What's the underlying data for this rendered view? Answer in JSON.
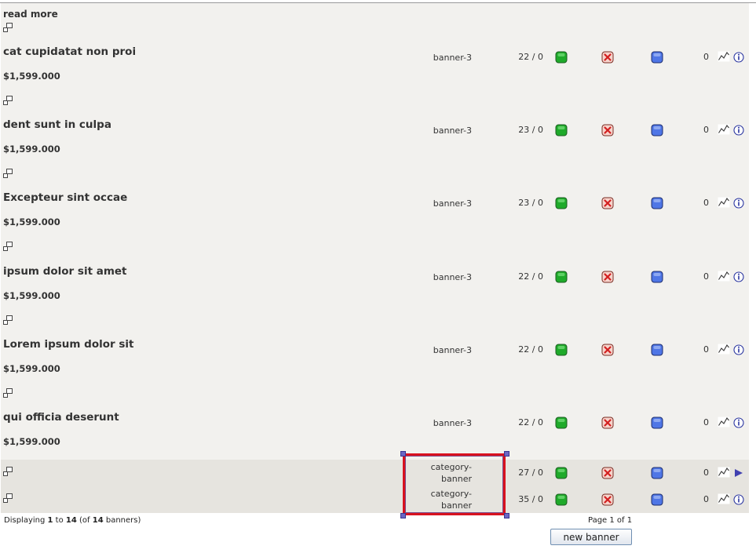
{
  "read_more": "read more",
  "banners": [
    {
      "title": "cat cupidatat non proi",
      "price": "$1,599.000",
      "zone": "banner-3",
      "ratio": "22 / 0",
      "count": "0",
      "last_icon": "info-icon"
    },
    {
      "title": "dent sunt in culpa",
      "price": "$1,599.000",
      "zone": "banner-3",
      "ratio": "23 / 0",
      "count": "0",
      "last_icon": "info-icon"
    },
    {
      "title": "Excepteur sint occae",
      "price": "$1,599.000",
      "zone": "banner-3",
      "ratio": "23 / 0",
      "count": "0",
      "last_icon": "info-icon"
    },
    {
      "title": "ipsum dolor sit amet",
      "price": "$1,599.000",
      "zone": "banner-3",
      "ratio": "22 / 0",
      "count": "0",
      "last_icon": "info-icon"
    },
    {
      "title": "Lorem ipsum dolor sit",
      "price": "$1,599.000",
      "zone": "banner-3",
      "ratio": "22 / 0",
      "count": "0",
      "last_icon": "info-icon"
    },
    {
      "title": "qui officia deserunt",
      "price": "$1,599.000",
      "zone": "banner-3",
      "ratio": "22 / 0",
      "count": "0",
      "last_icon": "info-icon"
    },
    {
      "title": "",
      "price": "",
      "zone": "category-\nbanner",
      "ratio": "27 / 0",
      "count": "0",
      "last_icon": "play-arrow-icon"
    },
    {
      "title": "",
      "price": "",
      "zone": "category-\nbanner",
      "ratio": "35 / 0",
      "count": "0",
      "last_icon": "info-icon"
    }
  ],
  "footer": {
    "displaying_label": "Displaying",
    "from": "1",
    "to_label": "to",
    "to": "14",
    "of_open": "(of",
    "total": "14",
    "total_suffix": "banners)",
    "page_info": "Page 1 of 1"
  },
  "new_banner_label": "new banner",
  "colors": {
    "panel_bg": "#f2f1ee",
    "row_shade": "#e6e4df",
    "status_green": "#1faa2a",
    "delete_red": "#d32020",
    "edit_blue": "#4f76e6",
    "highlight_red": "#d8121f"
  }
}
